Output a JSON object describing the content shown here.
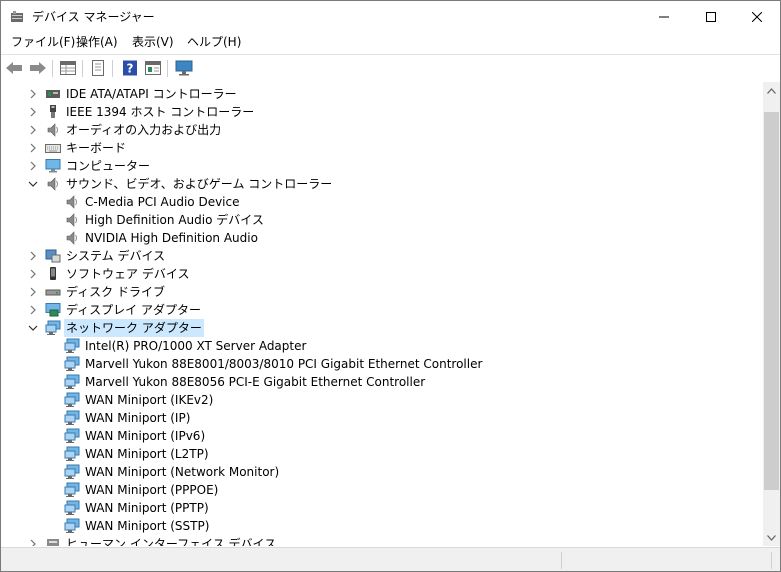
{
  "window": {
    "title": "デバイス マネージャー"
  },
  "menu": [
    {
      "label": "ファイル(F)"
    },
    {
      "label": "操作(A)"
    },
    {
      "label": "表示(V)"
    },
    {
      "label": "ヘルプ(H)"
    }
  ],
  "toolbar": [
    "back-icon",
    "forward-icon",
    "properties-grid-icon",
    "document-icon",
    "help-icon",
    "view-icon",
    "monitor-icon"
  ],
  "tree": [
    {
      "label": "IDE ATA/ATAPI コントローラー",
      "expanded": false,
      "icon": "ide-controller-icon"
    },
    {
      "label": "IEEE 1394 ホスト コントローラー",
      "expanded": false,
      "icon": "firewire-icon"
    },
    {
      "label": "オーディオの入力および出力",
      "expanded": false,
      "icon": "speaker-icon"
    },
    {
      "label": "キーボード",
      "expanded": false,
      "icon": "keyboard-icon"
    },
    {
      "label": "コンピューター",
      "expanded": false,
      "icon": "computer-icon"
    },
    {
      "label": "サウンド、ビデオ、およびゲーム コントローラー",
      "expanded": true,
      "icon": "speaker-icon",
      "children": [
        {
          "label": "C-Media PCI Audio Device",
          "icon": "speaker-icon"
        },
        {
          "label": "High Definition Audio デバイス",
          "icon": "speaker-icon"
        },
        {
          "label": "NVIDIA High Definition Audio",
          "icon": "speaker-icon"
        }
      ]
    },
    {
      "label": "システム デバイス",
      "expanded": false,
      "icon": "system-device-icon"
    },
    {
      "label": "ソフトウェア デバイス",
      "expanded": false,
      "icon": "software-device-icon"
    },
    {
      "label": "ディスク ドライブ",
      "expanded": false,
      "icon": "disk-drive-icon"
    },
    {
      "label": "ディスプレイ アダプター",
      "expanded": false,
      "icon": "display-adapter-icon"
    },
    {
      "label": "ネットワーク アダプター",
      "expanded": true,
      "selected": true,
      "icon": "network-adapter-icon",
      "children": [
        {
          "label": "Intel(R) PRO/1000 XT Server Adapter",
          "icon": "network-adapter-icon"
        },
        {
          "label": "Marvell Yukon 88E8001/8003/8010 PCI Gigabit Ethernet Controller",
          "icon": "network-adapter-icon"
        },
        {
          "label": "Marvell Yukon 88E8056 PCI-E Gigabit Ethernet Controller",
          "icon": "network-adapter-icon"
        },
        {
          "label": "WAN Miniport (IKEv2)",
          "icon": "network-adapter-icon"
        },
        {
          "label": "WAN Miniport (IP)",
          "icon": "network-adapter-icon"
        },
        {
          "label": "WAN Miniport (IPv6)",
          "icon": "network-adapter-icon"
        },
        {
          "label": "WAN Miniport (L2TP)",
          "icon": "network-adapter-icon"
        },
        {
          "label": "WAN Miniport (Network Monitor)",
          "icon": "network-adapter-icon"
        },
        {
          "label": "WAN Miniport (PPPOE)",
          "icon": "network-adapter-icon"
        },
        {
          "label": "WAN Miniport (PPTP)",
          "icon": "network-adapter-icon"
        },
        {
          "label": "WAN Miniport (SSTP)",
          "icon": "network-adapter-icon"
        }
      ]
    },
    {
      "label": "ヒューマン インターフェイス デバイス",
      "expanded": false,
      "icon": "hid-icon"
    }
  ],
  "colors": {
    "selection": "#cce8ff",
    "scroll_track": "#f0f0f0",
    "scroll_thumb": "#cdcdcd"
  }
}
